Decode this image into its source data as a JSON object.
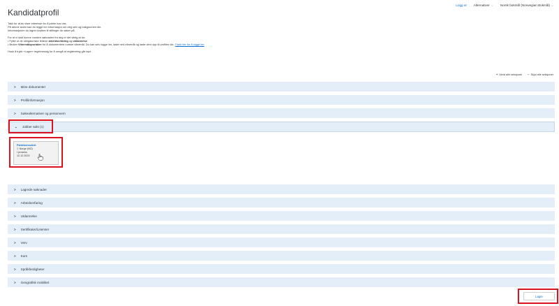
{
  "header": {
    "logout": "Logg ut",
    "alternatives": "Alternativer",
    "language": "Norsk bokmål (Norwegian Bokmål)"
  },
  "page_title": "Kandidatprofil",
  "intro": {
    "line1": "Takk for at du viser interesse for å jobbe hos oss.",
    "line2": "På denne siden kan du legge inn informasjon om deg selv og bakgrunnen din.",
    "line3": "Informasjonen du lagrer knyttes til stillinger du søker på.",
    "line4": "For at vi skal kunne vurdere søknaden fra deg er det viktig at du:",
    "bullet1_pre": "Fyller ut de obligatoriske feltene ",
    "bullet1_b1": "arbeidserfaring",
    "bullet1_mid": " og ",
    "bullet1_b2": "utdannelse",
    "bullet2_pre": "Bruker ",
    "bullet2_b": "Vitnemålsportalen",
    "bullet2_post": " for å dokumentere norske vitnemål. Du kan selv logge inn, laste ned vitnemål og laste dem opp til profilen din. ",
    "bullet2_link": "Trykk her for å logge inn",
    "line5": "Husk å trykk «Lagre» regelmessig for å unngå at registrering går tapt."
  },
  "expand_controls": {
    "expand_all": "Utvid alle seksjoner",
    "collapse_all": "Skjul alle seksjoner"
  },
  "sections": [
    {
      "label": "Mine dokumenter",
      "expanded": false
    },
    {
      "label": "Profilinformasjon",
      "expanded": false
    },
    {
      "label": "Søkealternativer og personvern",
      "expanded": false
    },
    {
      "label": "Jobber søkt (1)",
      "expanded": true
    },
    {
      "label": "Lagrede søknader",
      "expanded": false
    },
    {
      "label": "Arbeidserfaring",
      "expanded": false
    },
    {
      "label": "Utdannelse",
      "expanded": false
    },
    {
      "label": "Sertifikater/Lisenser",
      "expanded": false
    },
    {
      "label": "Verv",
      "expanded": false
    },
    {
      "label": "Kurs",
      "expanded": false
    },
    {
      "label": "Språkferdigheter",
      "expanded": false
    },
    {
      "label": "Geografisk mobilitet",
      "expanded": false
    }
  ],
  "job_card": {
    "title": "Pantekonsulent",
    "location": "Norge (NO)",
    "status": "I prosess",
    "date": "12.12.2023"
  },
  "save_label": "Lagre",
  "colors": {
    "accent": "#0a6ed1",
    "panel_bg": "#e3eef8",
    "highlight": "#d9141e"
  }
}
